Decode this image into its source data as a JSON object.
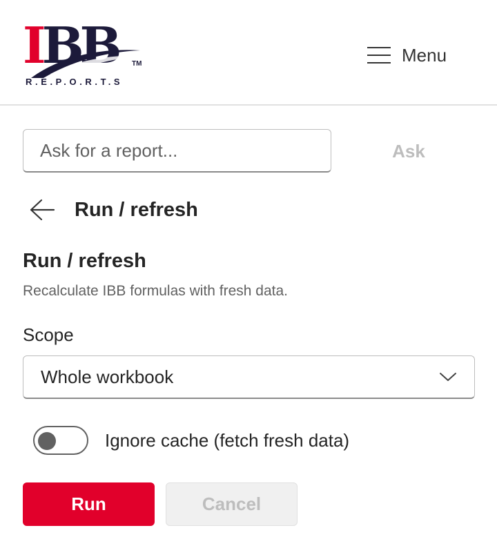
{
  "logo": {
    "letter_1": "I",
    "letters_rest": "BB",
    "tm": "TM",
    "tagline": "R.E.P.O.R.T.S",
    "swoosh_icon": "logo-swoosh-icon",
    "brand_red": "#e1002b",
    "brand_navy": "#1c1a3a"
  },
  "header": {
    "menu_label": "Menu",
    "menu_icon": "hamburger-icon"
  },
  "search": {
    "placeholder": "Ask for a report...",
    "value": "",
    "ask_label": "Ask"
  },
  "page": {
    "back_icon": "arrow-left-icon",
    "title": "Run / refresh"
  },
  "section": {
    "title": "Run / refresh",
    "description": "Recalculate IBB formulas with fresh data."
  },
  "scope": {
    "label": "Scope",
    "selected": "Whole workbook",
    "chevron_icon": "chevron-down-icon"
  },
  "options": {
    "ignore_cache_label": "Ignore cache (fetch fresh data)",
    "ignore_cache_enabled": false
  },
  "actions": {
    "run_label": "Run",
    "cancel_label": "Cancel",
    "cancel_enabled": false,
    "run_color": "#e1002b"
  }
}
